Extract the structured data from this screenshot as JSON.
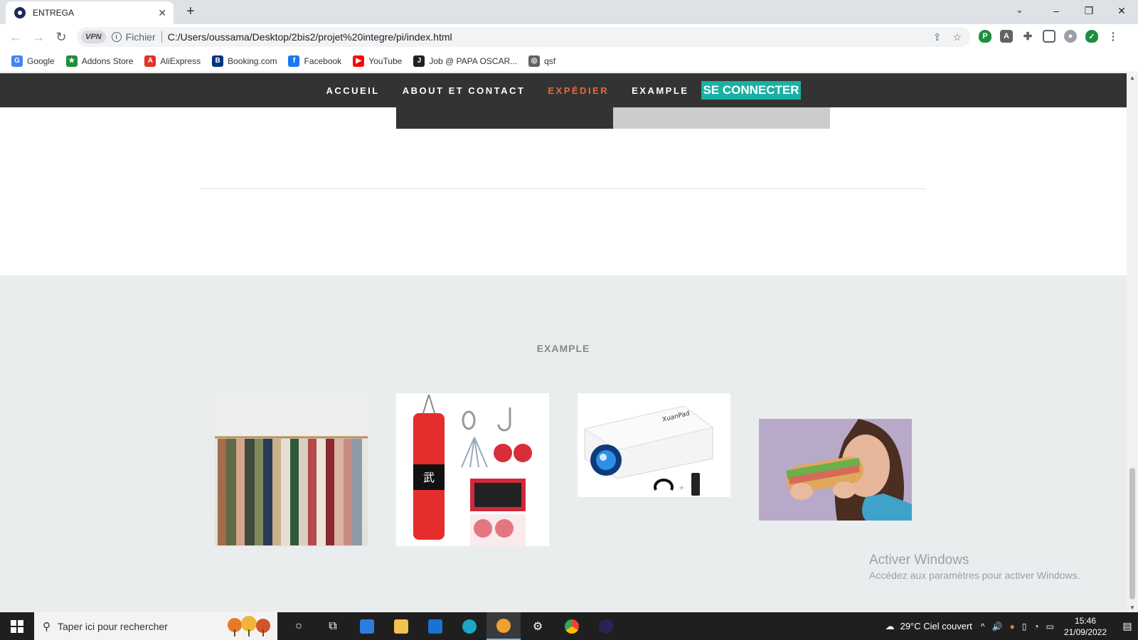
{
  "browser": {
    "tab_title": "ENTREGA",
    "tab_close": "✕",
    "new_tab": "+",
    "scheme_label": "Fichier",
    "url": "C:/Users/oussama/Desktop/2bis2/projet%20integre/pi/index.html",
    "vpn_label": "VPN",
    "window_controls": {
      "minimize": "–",
      "maximize": "❐",
      "close": "✕"
    },
    "bookmarks": [
      {
        "label": "Google",
        "icon": "google-icon",
        "color": "#4285f4",
        "glyph": "G"
      },
      {
        "label": "Addons Store",
        "icon": "addons-store-icon",
        "color": "#1e8e3e",
        "glyph": "★"
      },
      {
        "label": "AliExpress",
        "icon": "aliexpress-icon",
        "color": "#e43225",
        "glyph": "A"
      },
      {
        "label": "Booking.com",
        "icon": "booking-icon",
        "color": "#003580",
        "glyph": "B"
      },
      {
        "label": "Facebook",
        "icon": "facebook-icon",
        "color": "#1877f2",
        "glyph": "f"
      },
      {
        "label": "YouTube",
        "icon": "youtube-icon",
        "color": "#ff0000",
        "glyph": "▶"
      },
      {
        "label": "Job @ PAPA OSCAR...",
        "icon": "job-icon",
        "color": "#202124",
        "glyph": "J"
      },
      {
        "label": "qsf",
        "icon": "globe-icon",
        "color": "#5f6368",
        "glyph": "◎"
      }
    ]
  },
  "site": {
    "nav": {
      "home": "ACCUEIL",
      "about": "ABOUT ET CONTACT",
      "ship": "EXPÉDIER",
      "example": "EXAMPLE",
      "connect": "SE CONNECTER"
    },
    "section_title": "EXAMPLE",
    "products": [
      "clothes-rack-image",
      "punching-bag-kit-image",
      "projector-image",
      "woman-eating-sandwich-image"
    ],
    "accent_color": "#e66a3a",
    "connect_color": "#1ab0a3"
  },
  "watermark": {
    "title": "Activer Windows",
    "subtitle": "Accédez aux paramètres pour activer Windows."
  },
  "taskbar": {
    "search_placeholder": "Taper ici pour rechercher",
    "weather": "29°C  Ciel couvert",
    "time": "15:46",
    "date": "21/09/2022"
  }
}
